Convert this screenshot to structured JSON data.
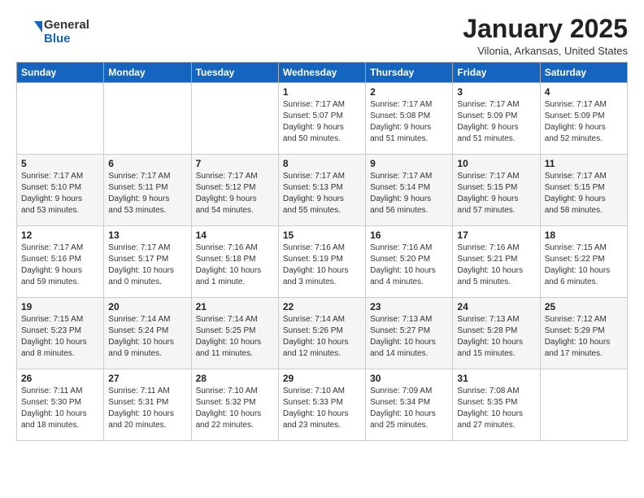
{
  "logo": {
    "general": "General",
    "blue": "Blue"
  },
  "title": "January 2025",
  "location": "Vilonia, Arkansas, United States",
  "weekdays": [
    "Sunday",
    "Monday",
    "Tuesday",
    "Wednesday",
    "Thursday",
    "Friday",
    "Saturday"
  ],
  "weeks": [
    [
      {
        "day": "",
        "info": ""
      },
      {
        "day": "",
        "info": ""
      },
      {
        "day": "",
        "info": ""
      },
      {
        "day": "1",
        "info": "Sunrise: 7:17 AM\nSunset: 5:07 PM\nDaylight: 9 hours\nand 50 minutes."
      },
      {
        "day": "2",
        "info": "Sunrise: 7:17 AM\nSunset: 5:08 PM\nDaylight: 9 hours\nand 51 minutes."
      },
      {
        "day": "3",
        "info": "Sunrise: 7:17 AM\nSunset: 5:09 PM\nDaylight: 9 hours\nand 51 minutes."
      },
      {
        "day": "4",
        "info": "Sunrise: 7:17 AM\nSunset: 5:09 PM\nDaylight: 9 hours\nand 52 minutes."
      }
    ],
    [
      {
        "day": "5",
        "info": "Sunrise: 7:17 AM\nSunset: 5:10 PM\nDaylight: 9 hours\nand 53 minutes."
      },
      {
        "day": "6",
        "info": "Sunrise: 7:17 AM\nSunset: 5:11 PM\nDaylight: 9 hours\nand 53 minutes."
      },
      {
        "day": "7",
        "info": "Sunrise: 7:17 AM\nSunset: 5:12 PM\nDaylight: 9 hours\nand 54 minutes."
      },
      {
        "day": "8",
        "info": "Sunrise: 7:17 AM\nSunset: 5:13 PM\nDaylight: 9 hours\nand 55 minutes."
      },
      {
        "day": "9",
        "info": "Sunrise: 7:17 AM\nSunset: 5:14 PM\nDaylight: 9 hours\nand 56 minutes."
      },
      {
        "day": "10",
        "info": "Sunrise: 7:17 AM\nSunset: 5:15 PM\nDaylight: 9 hours\nand 57 minutes."
      },
      {
        "day": "11",
        "info": "Sunrise: 7:17 AM\nSunset: 5:15 PM\nDaylight: 9 hours\nand 58 minutes."
      }
    ],
    [
      {
        "day": "12",
        "info": "Sunrise: 7:17 AM\nSunset: 5:16 PM\nDaylight: 9 hours\nand 59 minutes."
      },
      {
        "day": "13",
        "info": "Sunrise: 7:17 AM\nSunset: 5:17 PM\nDaylight: 10 hours\nand 0 minutes."
      },
      {
        "day": "14",
        "info": "Sunrise: 7:16 AM\nSunset: 5:18 PM\nDaylight: 10 hours\nand 1 minute."
      },
      {
        "day": "15",
        "info": "Sunrise: 7:16 AM\nSunset: 5:19 PM\nDaylight: 10 hours\nand 3 minutes."
      },
      {
        "day": "16",
        "info": "Sunrise: 7:16 AM\nSunset: 5:20 PM\nDaylight: 10 hours\nand 4 minutes."
      },
      {
        "day": "17",
        "info": "Sunrise: 7:16 AM\nSunset: 5:21 PM\nDaylight: 10 hours\nand 5 minutes."
      },
      {
        "day": "18",
        "info": "Sunrise: 7:15 AM\nSunset: 5:22 PM\nDaylight: 10 hours\nand 6 minutes."
      }
    ],
    [
      {
        "day": "19",
        "info": "Sunrise: 7:15 AM\nSunset: 5:23 PM\nDaylight: 10 hours\nand 8 minutes."
      },
      {
        "day": "20",
        "info": "Sunrise: 7:14 AM\nSunset: 5:24 PM\nDaylight: 10 hours\nand 9 minutes."
      },
      {
        "day": "21",
        "info": "Sunrise: 7:14 AM\nSunset: 5:25 PM\nDaylight: 10 hours\nand 11 minutes."
      },
      {
        "day": "22",
        "info": "Sunrise: 7:14 AM\nSunset: 5:26 PM\nDaylight: 10 hours\nand 12 minutes."
      },
      {
        "day": "23",
        "info": "Sunrise: 7:13 AM\nSunset: 5:27 PM\nDaylight: 10 hours\nand 14 minutes."
      },
      {
        "day": "24",
        "info": "Sunrise: 7:13 AM\nSunset: 5:28 PM\nDaylight: 10 hours\nand 15 minutes."
      },
      {
        "day": "25",
        "info": "Sunrise: 7:12 AM\nSunset: 5:29 PM\nDaylight: 10 hours\nand 17 minutes."
      }
    ],
    [
      {
        "day": "26",
        "info": "Sunrise: 7:11 AM\nSunset: 5:30 PM\nDaylight: 10 hours\nand 18 minutes."
      },
      {
        "day": "27",
        "info": "Sunrise: 7:11 AM\nSunset: 5:31 PM\nDaylight: 10 hours\nand 20 minutes."
      },
      {
        "day": "28",
        "info": "Sunrise: 7:10 AM\nSunset: 5:32 PM\nDaylight: 10 hours\nand 22 minutes."
      },
      {
        "day": "29",
        "info": "Sunrise: 7:10 AM\nSunset: 5:33 PM\nDaylight: 10 hours\nand 23 minutes."
      },
      {
        "day": "30",
        "info": "Sunrise: 7:09 AM\nSunset: 5:34 PM\nDaylight: 10 hours\nand 25 minutes."
      },
      {
        "day": "31",
        "info": "Sunrise: 7:08 AM\nSunset: 5:35 PM\nDaylight: 10 hours\nand 27 minutes."
      },
      {
        "day": "",
        "info": ""
      }
    ]
  ]
}
